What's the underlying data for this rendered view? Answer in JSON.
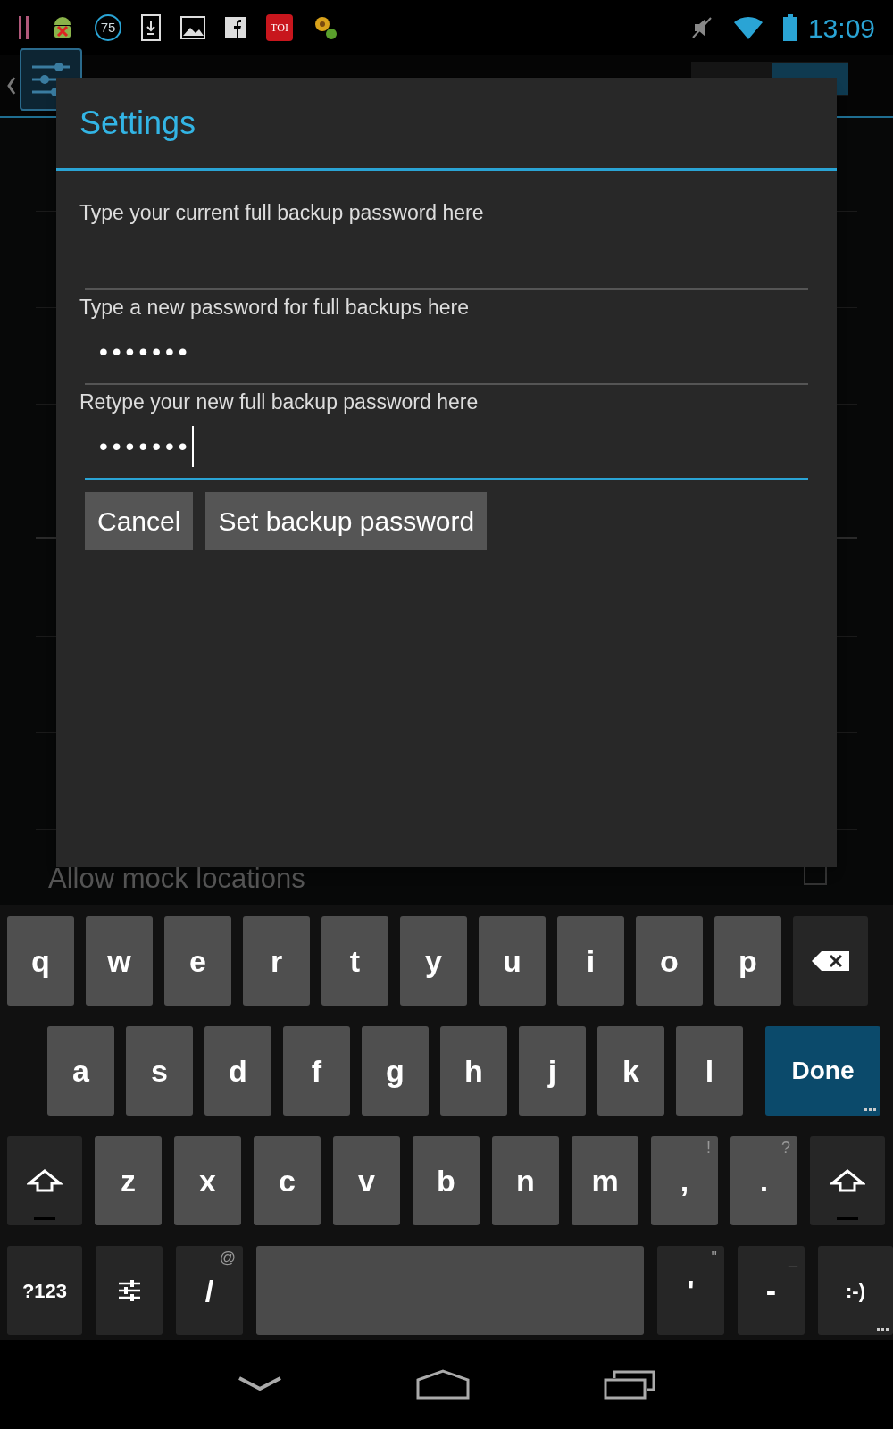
{
  "status_bar": {
    "notifications": [
      {
        "kind": "bars"
      },
      {
        "kind": "android"
      },
      {
        "kind": "badge",
        "text": "75"
      },
      {
        "kind": "download"
      },
      {
        "kind": "gallery"
      },
      {
        "kind": "facebook"
      },
      {
        "kind": "toi",
        "text": "TOI"
      },
      {
        "kind": "flower"
      }
    ],
    "time": "13:09"
  },
  "action_bar": {
    "toggle": {
      "on": true
    }
  },
  "background_list": [
    {
      "title": "Allow mock locations",
      "checked": false
    }
  ],
  "dialog": {
    "title": "Settings",
    "fields": [
      {
        "label": "Type your current full backup password here",
        "focused": false
      },
      {
        "label": "Type a new password for full backups here",
        "value": "•••••••",
        "focused": false
      },
      {
        "label": "Retype your new full backup password here",
        "value": "•••••••",
        "focused": true
      }
    ],
    "buttons": [
      "Cancel",
      "Set backup password"
    ]
  },
  "keyboard": {
    "top_row": [
      {
        "kind": "letter",
        "label": "q"
      },
      {
        "kind": "letter",
        "label": "w"
      },
      {
        "kind": "letter",
        "label": "e"
      },
      {
        "kind": "letter",
        "label": "r"
      },
      {
        "kind": "letter",
        "label": "t"
      },
      {
        "kind": "letter",
        "label": "y"
      },
      {
        "kind": "letter",
        "label": "u"
      },
      {
        "kind": "letter",
        "label": "i"
      },
      {
        "kind": "letter",
        "label": "o"
      },
      {
        "kind": "letter",
        "label": "p"
      },
      {
        "kind": "backspace"
      }
    ],
    "home_row": [
      {
        "kind": "letter",
        "label": "a"
      },
      {
        "kind": "letter",
        "label": "s"
      },
      {
        "kind": "letter",
        "label": "d"
      },
      {
        "kind": "letter",
        "label": "f"
      },
      {
        "kind": "letter",
        "label": "g"
      },
      {
        "kind": "letter",
        "label": "h"
      },
      {
        "kind": "letter",
        "label": "j"
      },
      {
        "kind": "letter",
        "label": "k"
      },
      {
        "kind": "letter",
        "label": "l"
      },
      {
        "kind": "done",
        "label": "Done",
        "more": true
      }
    ],
    "bottom_row": [
      {
        "kind": "shift"
      },
      {
        "kind": "letter",
        "label": "z"
      },
      {
        "kind": "letter",
        "label": "x"
      },
      {
        "kind": "letter",
        "label": "c"
      },
      {
        "kind": "letter",
        "label": "v"
      },
      {
        "kind": "letter",
        "label": "b"
      },
      {
        "kind": "letter",
        "label": "n"
      },
      {
        "kind": "letter",
        "label": "m"
      },
      {
        "kind": "letter",
        "label": ",",
        "hint": "!"
      },
      {
        "kind": "letter",
        "label": ".",
        "hint": "?"
      },
      {
        "kind": "shift"
      }
    ],
    "space_row": [
      {
        "kind": "function",
        "label": "?123"
      },
      {
        "kind": "settings"
      },
      {
        "kind": "function",
        "label": "/",
        "hint": "@"
      },
      {
        "kind": "space"
      },
      {
        "kind": "function",
        "label": "'",
        "hint": "\""
      },
      {
        "kind": "function",
        "label": "-",
        "hint": "_"
      },
      {
        "kind": "function",
        "label": ":-)",
        "more": true
      }
    ]
  },
  "nav_bar": [
    {
      "kind": "back"
    },
    {
      "kind": "home"
    },
    {
      "kind": "recents"
    }
  ]
}
